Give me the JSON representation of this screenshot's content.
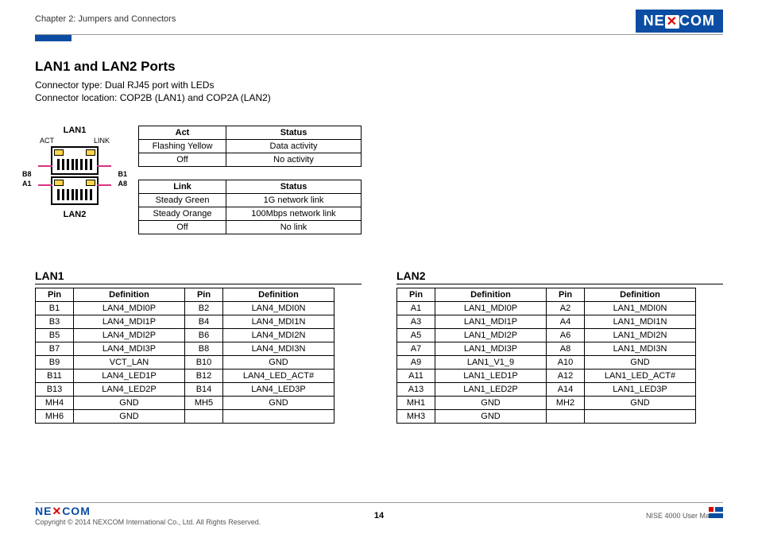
{
  "header": {
    "chapter": "Chapter 2: Jumpers and Connectors",
    "brand": "NEXCOM"
  },
  "section": {
    "title": "LAN1 and LAN2 Ports",
    "connector_type": "Connector type: Dual RJ45 port with LEDs",
    "connector_location": "Connector location: COP2B (LAN1) and COP2A (LAN2)"
  },
  "diagram": {
    "lan1_label": "LAN1",
    "lan2_label": "LAN2",
    "act_label": "ACT",
    "link_label": "LINK",
    "b8": "B8",
    "b1": "B1",
    "a1": "A1",
    "a8": "A8"
  },
  "act_table": {
    "headers": [
      "Act",
      "Status"
    ],
    "rows": [
      [
        "Flashing Yellow",
        "Data activity"
      ],
      [
        "Off",
        "No activity"
      ]
    ]
  },
  "link_table": {
    "headers": [
      "Link",
      "Status"
    ],
    "rows": [
      [
        "Steady Green",
        "1G network link"
      ],
      [
        "Steady Orange",
        "100Mbps network link"
      ],
      [
        "Off",
        "No link"
      ]
    ]
  },
  "lan1": {
    "title": "LAN1",
    "headers": [
      "Pin",
      "Definition",
      "Pin",
      "Definition"
    ],
    "rows": [
      [
        "B1",
        "LAN4_MDI0P",
        "B2",
        "LAN4_MDI0N"
      ],
      [
        "B3",
        "LAN4_MDI1P",
        "B4",
        "LAN4_MDI1N"
      ],
      [
        "B5",
        "LAN4_MDI2P",
        "B6",
        "LAN4_MDI2N"
      ],
      [
        "B7",
        "LAN4_MDI3P",
        "B8",
        "LAN4_MDI3N"
      ],
      [
        "B9",
        "VCT_LAN",
        "B10",
        "GND"
      ],
      [
        "B11",
        "LAN4_LED1P",
        "B12",
        "LAN4_LED_ACT#"
      ],
      [
        "B13",
        "LAN4_LED2P",
        "B14",
        "LAN4_LED3P"
      ],
      [
        "MH4",
        "GND",
        "MH5",
        "GND"
      ],
      [
        "MH6",
        "GND",
        "",
        ""
      ]
    ]
  },
  "lan2": {
    "title": "LAN2",
    "headers": [
      "Pin",
      "Definition",
      "Pin",
      "Definition"
    ],
    "rows": [
      [
        "A1",
        "LAN1_MDI0P",
        "A2",
        "LAN1_MDI0N"
      ],
      [
        "A3",
        "LAN1_MDI1P",
        "A4",
        "LAN1_MDI1N"
      ],
      [
        "A5",
        "LAN1_MDI2P",
        "A6",
        "LAN1_MDI2N"
      ],
      [
        "A7",
        "LAN1_MDI3P",
        "A8",
        "LAN1_MDI3N"
      ],
      [
        "A9",
        "LAN1_V1_9",
        "A10",
        "GND"
      ],
      [
        "A11",
        "LAN1_LED1P",
        "A12",
        "LAN1_LED_ACT#"
      ],
      [
        "A13",
        "LAN1_LED2P",
        "A14",
        "LAN1_LED3P"
      ],
      [
        "MH1",
        "GND",
        "MH2",
        "GND"
      ],
      [
        "MH3",
        "GND",
        "",
        ""
      ]
    ]
  },
  "footer": {
    "brand": "NEXCOM",
    "copyright": "Copyright © 2014 NEXCOM International Co., Ltd. All Rights Reserved.",
    "page": "14",
    "manual": "NISE 4000 User Manual"
  }
}
